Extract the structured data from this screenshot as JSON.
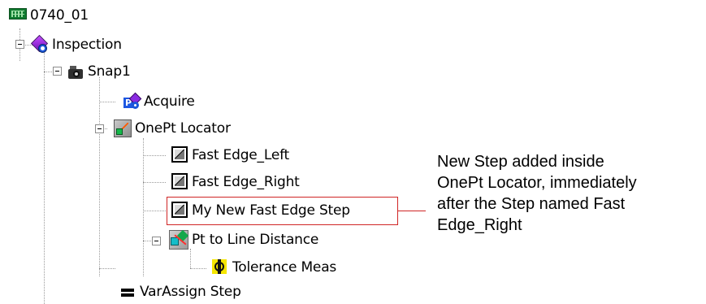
{
  "tree": {
    "root": {
      "label": "0740_01",
      "icon": "chip-icon"
    },
    "inspection": {
      "label": "Inspection",
      "icon": "inspection-icon"
    },
    "snap1": {
      "label": "Snap1",
      "icon": "camera-icon"
    },
    "acquire": {
      "label": "Acquire",
      "icon": "acquire-icon"
    },
    "onept_locator": {
      "label": "OnePt Locator",
      "icon": "locator-icon"
    },
    "fast_edge_left": {
      "label": "Fast Edge_Left",
      "icon": "edge-step-icon"
    },
    "fast_edge_right": {
      "label": "Fast Edge_Right",
      "icon": "edge-step-icon"
    },
    "my_new_fast_edge_step": {
      "label": "My New Fast Edge Step",
      "icon": "edge-step-icon"
    },
    "pt_to_line_distance": {
      "label": "Pt to Line Distance",
      "icon": "pt-line-icon"
    },
    "tolerance_meas": {
      "label": "Tolerance Meas",
      "icon": "tolerance-icon"
    },
    "varassign_step": {
      "label": "VarAssign Step",
      "icon": "varassign-icon"
    }
  },
  "annotation": {
    "text": "New Step added inside\nOnePt Locator, immediately\nafter the Step named Fast\nEdge_Right",
    "highlight_color": "#d02525"
  }
}
